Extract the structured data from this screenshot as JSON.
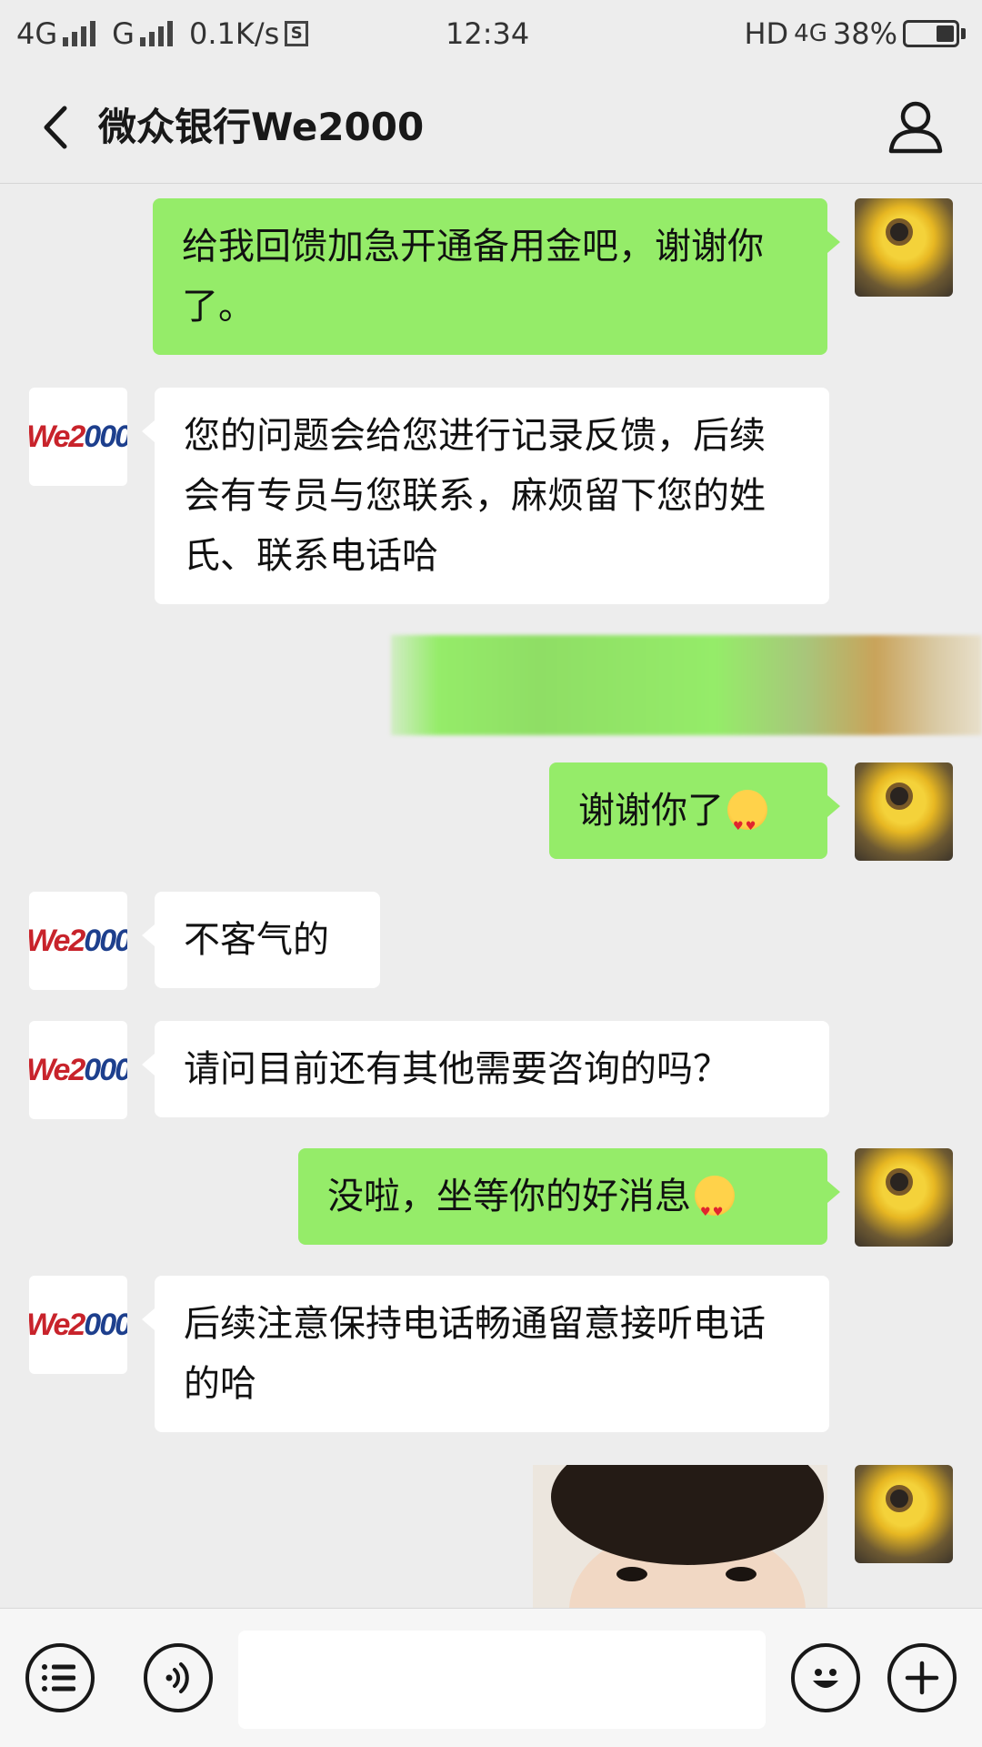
{
  "status_bar": {
    "network1": "4G",
    "network2": "G",
    "speed": "0.1K/s",
    "s_icon": "S",
    "time": "12:34",
    "hd": "HD",
    "network3": "4G",
    "battery": "38%",
    "battery_level": 0.38
  },
  "header": {
    "title": "微众银行We2000"
  },
  "bot_logo": {
    "a": "We2",
    "b": "000"
  },
  "messages": [
    {
      "from": "user",
      "text": "给我回馈加急开通备用金吧，谢谢你了。"
    },
    {
      "from": "bot",
      "text": "您的问题会给您进行记录反馈，后续会有专员与您联系，麻烦留下您的姓氏、联系电话哈"
    },
    {
      "from": "user",
      "text": "谢谢你了"
    },
    {
      "from": "bot",
      "text": "不客气的"
    },
    {
      "from": "bot",
      "text": "请问目前还有其他需要咨询的吗？"
    },
    {
      "from": "user",
      "text": "没啦，坐等你的好消息"
    },
    {
      "from": "bot",
      "text": "后续注意保持电话畅通留意接听电话的哈"
    }
  ],
  "input_bar": {
    "value": ""
  },
  "icons": [
    "back-arrow",
    "person",
    "menu-list",
    "voice",
    "emoji-smile",
    "plus"
  ]
}
